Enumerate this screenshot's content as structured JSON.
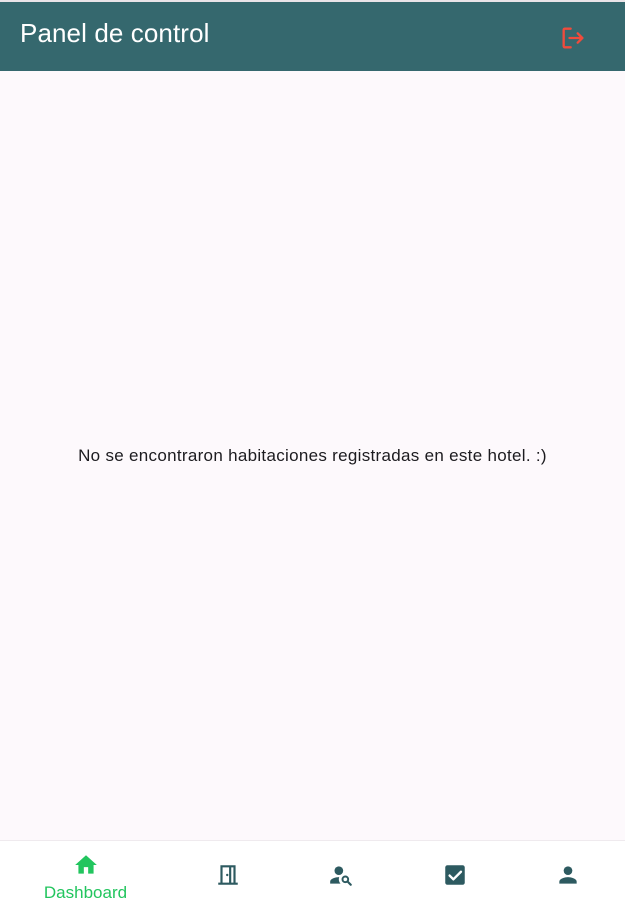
{
  "header": {
    "title": "Panel de control",
    "logout_icon": "logout-icon",
    "logout_color": "#f04b3c"
  },
  "main": {
    "empty_message": "No se encontraron habitaciones registradas en este hotel. :)"
  },
  "bottom_nav": {
    "active_color": "#22c55e",
    "inactive_color": "#2d5a60",
    "items": [
      {
        "icon": "home-icon",
        "label": "Dashboard",
        "active": true
      },
      {
        "icon": "door-icon",
        "label": "",
        "active": false
      },
      {
        "icon": "person-search-icon",
        "label": "",
        "active": false
      },
      {
        "icon": "checkbox-icon",
        "label": "",
        "active": false
      },
      {
        "icon": "person-icon",
        "label": "",
        "active": false
      }
    ]
  }
}
